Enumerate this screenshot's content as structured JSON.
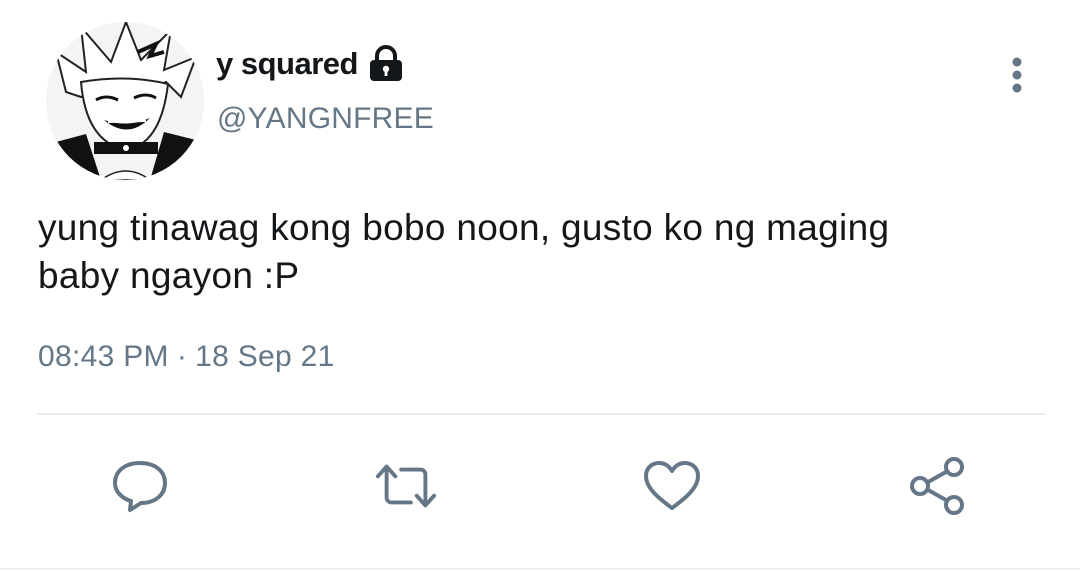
{
  "tweet": {
    "author": {
      "display_name": "y squared",
      "handle": "@YANGNFREE",
      "protected": true
    },
    "text_line1": "yung tinawag kong bobo noon, gusto ko ng maging",
    "text_line2": "baby ngayon :P",
    "time": "08:43 PM",
    "separator": "·",
    "date": "18 Sep 21"
  },
  "icons": {
    "lock": "lock-icon",
    "more": "more-vertical-icon",
    "reply": "reply-icon",
    "retweet": "retweet-icon",
    "like": "heart-icon",
    "share": "share-icon"
  },
  "colors": {
    "text": "#14171a",
    "secondary": "#657786",
    "divider": "#e6ecf0"
  }
}
